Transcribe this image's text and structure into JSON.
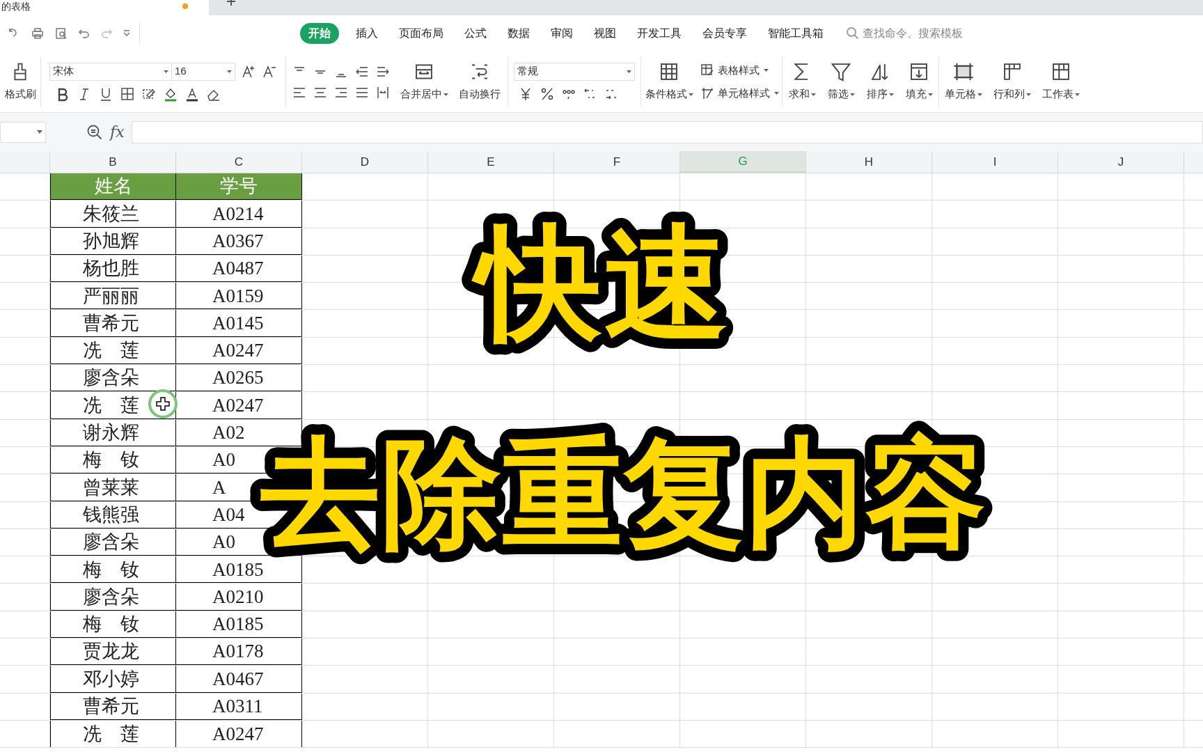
{
  "document_tab": {
    "title": "的表格"
  },
  "menu_tabs": [
    {
      "label": "开始",
      "selected": true
    },
    {
      "label": "插入",
      "selected": false
    },
    {
      "label": "页面布局",
      "selected": false
    },
    {
      "label": "公式",
      "selected": false
    },
    {
      "label": "数据",
      "selected": false
    },
    {
      "label": "审阅",
      "selected": false
    },
    {
      "label": "视图",
      "selected": false
    },
    {
      "label": "开发工具",
      "selected": false
    },
    {
      "label": "会员专享",
      "selected": false
    },
    {
      "label": "智能工具箱",
      "selected": false
    }
  ],
  "search": {
    "placeholder": "查找命令、搜索模板"
  },
  "ribbon": {
    "format_painter": "格式刷",
    "font": "宋体",
    "font_size": "16",
    "number_format": "常规",
    "merge": "合并居中",
    "wrap": "自动换行",
    "conditional": "条件格式",
    "table_style": "表格样式",
    "cell_style": "单元格样式",
    "tools": [
      "求和",
      "筛选",
      "排序",
      "填充"
    ],
    "cells": [
      "单元格",
      "行和列",
      "工作表"
    ]
  },
  "formula_bar": {
    "fx": "fx"
  },
  "columns": [
    {
      "label": "B",
      "selected": false
    },
    {
      "label": "C",
      "selected": false
    },
    {
      "label": "D",
      "selected": false
    },
    {
      "label": "E",
      "selected": false
    },
    {
      "label": "F",
      "selected": false
    },
    {
      "label": "G",
      "selected": true
    },
    {
      "label": "H",
      "selected": false
    },
    {
      "label": "I",
      "selected": false
    },
    {
      "label": "J",
      "selected": false
    }
  ],
  "table": {
    "header": [
      "姓名",
      "学号"
    ],
    "rows": [
      [
        "朱筱兰",
        "A0214"
      ],
      [
        "孙旭辉",
        "A0367"
      ],
      [
        "杨也胜",
        "A0487"
      ],
      [
        "严丽丽",
        "A0159"
      ],
      [
        "曹希元",
        "A0145"
      ],
      [
        "冼　莲",
        "A0247"
      ],
      [
        "廖含朵",
        "A0265"
      ],
      [
        "冼　莲",
        "A0247"
      ],
      [
        "谢永辉",
        "A02"
      ],
      [
        "梅　钕",
        "A0"
      ],
      [
        "曾莱莱",
        "A"
      ],
      [
        "钱熊强",
        "A04"
      ],
      [
        "廖含朵",
        "A0"
      ],
      [
        "梅　钕",
        "A0185"
      ],
      [
        "廖含朵",
        "A0210"
      ],
      [
        "梅　钕",
        "A0185"
      ],
      [
        "贾龙龙",
        "A0178"
      ],
      [
        "邓小婷",
        "A0467"
      ],
      [
        "曹希元",
        "A0311"
      ],
      [
        "冼　莲",
        "A0247"
      ]
    ]
  },
  "overlay": {
    "lines": [
      "快速",
      "去除重复内容"
    ]
  }
}
